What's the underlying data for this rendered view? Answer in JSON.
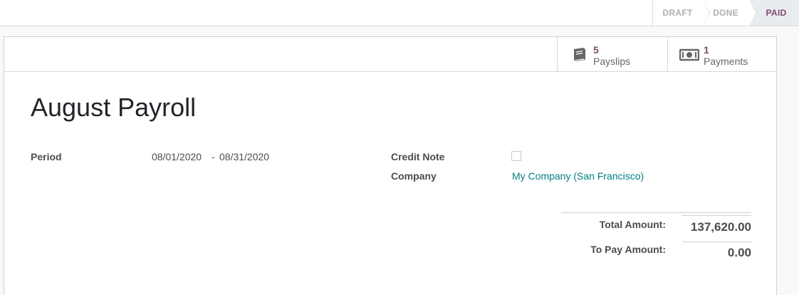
{
  "statusbar": {
    "stages": [
      {
        "label": "DRAFT",
        "active": false
      },
      {
        "label": "DONE",
        "active": false
      },
      {
        "label": "PAID",
        "active": true
      }
    ]
  },
  "smart_buttons": {
    "payslips": {
      "value": "5",
      "label": "Payslips",
      "icon": "book-icon"
    },
    "payments": {
      "value": "1",
      "label": "Payments",
      "icon": "money-icon"
    }
  },
  "record": {
    "title": "August Payroll",
    "period_label": "Period",
    "period_start": "08/01/2020",
    "period_separator": "-",
    "period_end": "08/31/2020",
    "credit_note_label": "Credit Note",
    "credit_note_checked": false,
    "company_label": "Company",
    "company_value": "My Company (San Francisco)"
  },
  "totals": {
    "total_amount_label": "Total Amount:",
    "total_amount_value": "137,620.00",
    "to_pay_label": "To Pay Amount:",
    "to_pay_value": "0.00"
  },
  "colors": {
    "accent": "#7c4a6d",
    "link": "#017e84",
    "active_stage_bg": "#e9ecef"
  }
}
